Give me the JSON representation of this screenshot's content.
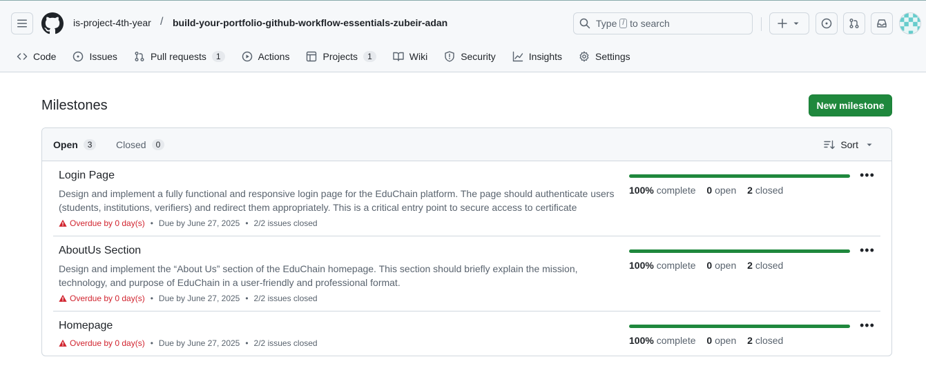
{
  "header": {
    "owner": "is-project-4th-year",
    "separator": "/",
    "repo": "build-your-portfolio-github-workflow-essentials-zubeir-adan",
    "search_prefix": "Type",
    "search_key": "/",
    "search_suffix": "to search"
  },
  "tabs": [
    {
      "label": "Code",
      "icon": "code-icon"
    },
    {
      "label": "Issues",
      "icon": "issue-icon"
    },
    {
      "label": "Pull requests",
      "icon": "pull-request-icon",
      "count": "1"
    },
    {
      "label": "Actions",
      "icon": "play-icon"
    },
    {
      "label": "Projects",
      "icon": "table-icon",
      "count": "1"
    },
    {
      "label": "Wiki",
      "icon": "book-icon"
    },
    {
      "label": "Security",
      "icon": "shield-icon"
    },
    {
      "label": "Insights",
      "icon": "graph-icon"
    },
    {
      "label": "Settings",
      "icon": "gear-icon"
    }
  ],
  "page": {
    "title": "Milestones",
    "new_button": "New milestone"
  },
  "filter": {
    "open_label": "Open",
    "open_count": "3",
    "closed_label": "Closed",
    "closed_count": "0",
    "sort_label": "Sort"
  },
  "milestones": [
    {
      "title": "Login Page",
      "description": "Design and implement a fully functional and responsive login page for the EduChain platform. The page should authenticate users (students, institutions, verifiers) and redirect them appropriately. This is a critical entry point to secure access to certificate issuance…",
      "overdue": "Overdue by 0 day(s)",
      "due": "Due by June 27, 2025",
      "issues": "2/2 issues closed",
      "percent": "100%",
      "complete_label": "complete",
      "open_count": "0",
      "open_label": "open",
      "closed_count": "2",
      "closed_label": "closed",
      "progress": 1.0
    },
    {
      "title": "AboutUs Section",
      "description": "Design and implement the “About Us” section of the EduChain homepage. This section should briefly explain the mission, technology, and purpose of EduChain in a user-friendly and professional format.",
      "overdue": "Overdue by 0 day(s)",
      "due": "Due by June 27, 2025",
      "issues": "2/2 issues closed",
      "percent": "100%",
      "complete_label": "complete",
      "open_count": "0",
      "open_label": "open",
      "closed_count": "2",
      "closed_label": "closed",
      "progress": 1.0
    },
    {
      "title": "Homepage",
      "description": "",
      "overdue": "Overdue by 0 day(s)",
      "due": "Due by June 27, 2025",
      "issues": "2/2 issues closed",
      "percent": "100%",
      "complete_label": "complete",
      "open_count": "0",
      "open_label": "open",
      "closed_count": "2",
      "closed_label": "closed",
      "progress": 1.0
    }
  ],
  "colors": {
    "accent": "#1f883d",
    "danger": "#d1242f"
  }
}
